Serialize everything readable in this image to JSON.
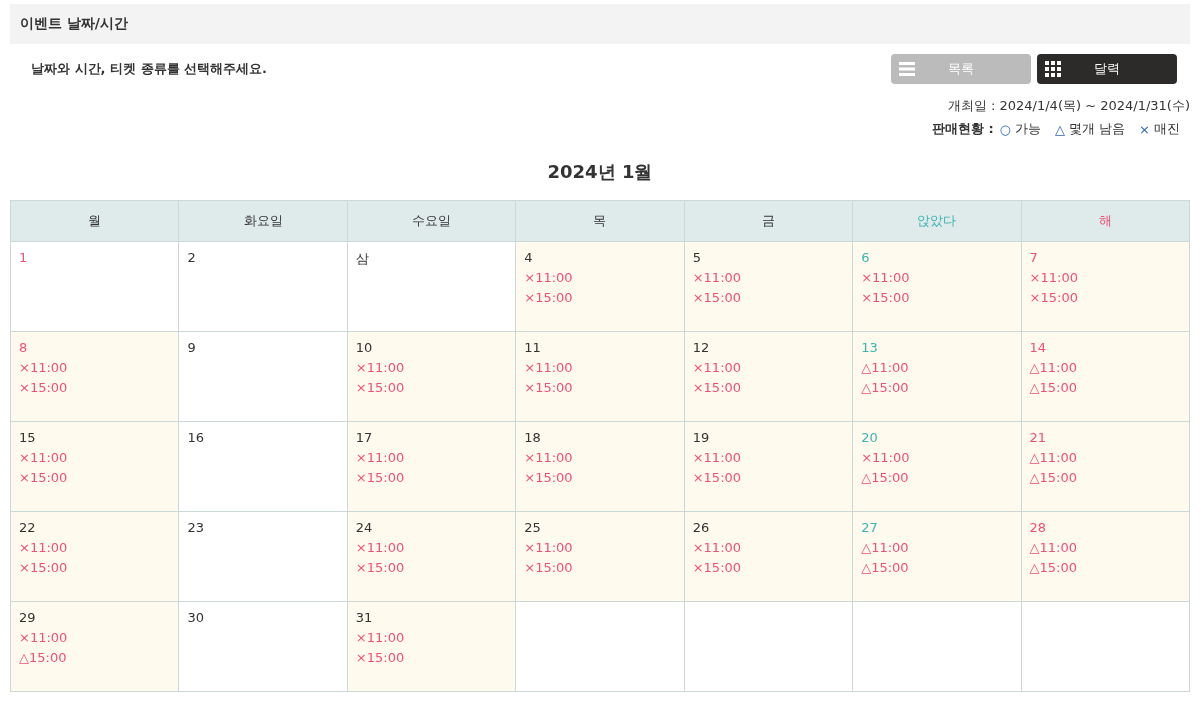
{
  "section": {
    "title": "이벤트 날짜/시간"
  },
  "instruction": "날짜와 시간, 티켓 종류를 선택해주세요.",
  "view_buttons": [
    {
      "label": "목록",
      "kind": "list",
      "selected": false
    },
    {
      "label": "달력",
      "kind": "calendar",
      "selected": true
    }
  ],
  "event_period": "개최일 : 2024/1/4(목) ~ 2024/1/31(수)",
  "legend": {
    "label": "판매현황 :",
    "items": [
      {
        "symbol": "○",
        "text": "가능"
      },
      {
        "symbol": "△",
        "text": "몇개 남음"
      },
      {
        "symbol": "×",
        "text": "매진"
      }
    ]
  },
  "calendar": {
    "title": "2024년  1월",
    "headers": [
      {
        "label": "월",
        "kind": "weekday"
      },
      {
        "label": "화요일",
        "kind": "weekday"
      },
      {
        "label": "수요일",
        "kind": "weekday"
      },
      {
        "label": "목",
        "kind": "weekday"
      },
      {
        "label": "금",
        "kind": "weekday"
      },
      {
        "label": "앉았다",
        "kind": "saturday"
      },
      {
        "label": "해",
        "kind": "holiday"
      }
    ],
    "weeks": [
      [
        {
          "day": "1",
          "kind": "holiday"
        },
        {
          "day": "2",
          "kind": "weekday"
        },
        {
          "day": "삼",
          "kind": "weekday"
        },
        {
          "day": "4",
          "kind": "weekday",
          "sessions": [
            "×11:00",
            "×15:00"
          ]
        },
        {
          "day": "5",
          "kind": "weekday",
          "sessions": [
            "×11:00",
            "×15:00"
          ]
        },
        {
          "day": "6",
          "kind": "saturday",
          "sessions": [
            "×11:00",
            "×15:00"
          ]
        },
        {
          "day": "7",
          "kind": "holiday",
          "sessions": [
            "×11:00",
            "×15:00"
          ]
        }
      ],
      [
        {
          "day": "8",
          "kind": "holiday",
          "sessions": [
            "×11:00",
            "×15:00"
          ]
        },
        {
          "day": "9",
          "kind": "weekday"
        },
        {
          "day": "10",
          "kind": "weekday",
          "sessions": [
            "×11:00",
            "×15:00"
          ]
        },
        {
          "day": "11",
          "kind": "weekday",
          "sessions": [
            "×11:00",
            "×15:00"
          ]
        },
        {
          "day": "12",
          "kind": "weekday",
          "sessions": [
            "×11:00",
            "×15:00"
          ]
        },
        {
          "day": "13",
          "kind": "saturday",
          "sessions": [
            "△11:00",
            "△15:00"
          ]
        },
        {
          "day": "14",
          "kind": "holiday",
          "sessions": [
            "△11:00",
            "△15:00"
          ]
        }
      ],
      [
        {
          "day": "15",
          "kind": "weekday",
          "sessions": [
            "×11:00",
            "×15:00"
          ]
        },
        {
          "day": "16",
          "kind": "weekday"
        },
        {
          "day": "17",
          "kind": "weekday",
          "sessions": [
            "×11:00",
            "×15:00"
          ]
        },
        {
          "day": "18",
          "kind": "weekday",
          "sessions": [
            "×11:00",
            "×15:00"
          ]
        },
        {
          "day": "19",
          "kind": "weekday",
          "sessions": [
            "×11:00",
            "×15:00"
          ]
        },
        {
          "day": "20",
          "kind": "saturday",
          "sessions": [
            "×11:00",
            "△15:00"
          ]
        },
        {
          "day": "21",
          "kind": "holiday",
          "sessions": [
            "△11:00",
            "△15:00"
          ]
        }
      ],
      [
        {
          "day": "22",
          "kind": "weekday",
          "sessions": [
            "×11:00",
            "×15:00"
          ]
        },
        {
          "day": "23",
          "kind": "weekday"
        },
        {
          "day": "24",
          "kind": "weekday",
          "sessions": [
            "×11:00",
            "×15:00"
          ]
        },
        {
          "day": "25",
          "kind": "weekday",
          "sessions": [
            "×11:00",
            "×15:00"
          ]
        },
        {
          "day": "26",
          "kind": "weekday",
          "sessions": [
            "×11:00",
            "×15:00"
          ]
        },
        {
          "day": "27",
          "kind": "saturday",
          "sessions": [
            "△11:00",
            "△15:00"
          ]
        },
        {
          "day": "28",
          "kind": "holiday",
          "sessions": [
            "△11:00",
            "△15:00"
          ]
        }
      ],
      [
        {
          "day": "29",
          "kind": "weekday",
          "sessions": [
            "×11:00",
            "△15:00"
          ]
        },
        {
          "day": "30",
          "kind": "weekday"
        },
        {
          "day": "31",
          "kind": "weekday",
          "sessions": [
            "×11:00",
            "×15:00"
          ]
        },
        {
          "kind": "empty"
        },
        {
          "kind": "empty"
        },
        {
          "kind": "empty"
        },
        {
          "kind": "empty"
        }
      ]
    ]
  }
}
